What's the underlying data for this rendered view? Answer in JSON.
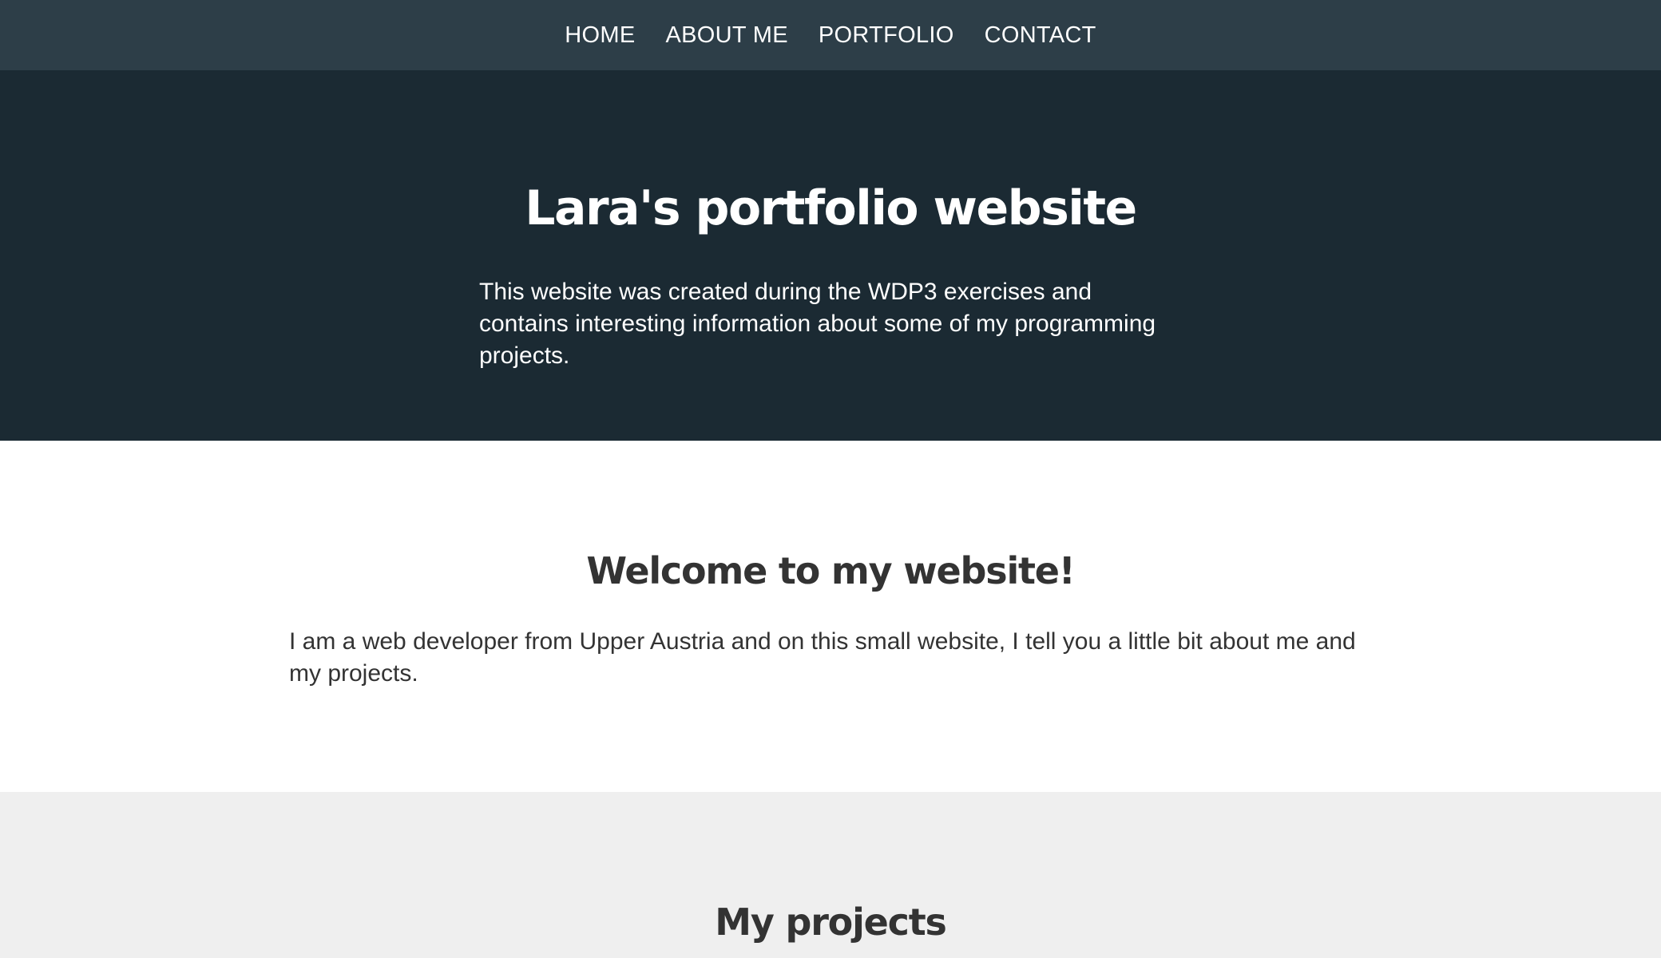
{
  "nav": {
    "items": [
      {
        "label": "HOME"
      },
      {
        "label": "ABOUT ME"
      },
      {
        "label": "PORTFOLIO"
      },
      {
        "label": "CONTACT"
      }
    ]
  },
  "hero": {
    "title": "Lara's portfolio website",
    "text": "This website was created during the WDP3 exercises and contains interesting information about some of my programming projects."
  },
  "welcome": {
    "title": "Welcome to my website!",
    "text": "I am a web developer from Upper Austria and on this small website, I tell you a little bit about me and my projects."
  },
  "projects": {
    "title": "My projects"
  },
  "colors": {
    "nav_bg": "#2d3e48",
    "hero_bg": "#1b2a33",
    "section_light_bg": "#ffffff",
    "section_gray_bg": "#efefef",
    "text_dark": "#333333",
    "text_light": "#ffffff"
  }
}
